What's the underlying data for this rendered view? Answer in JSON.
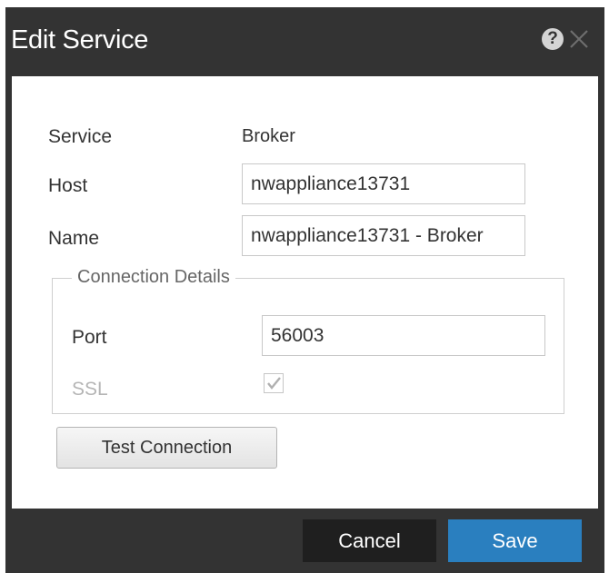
{
  "dialog": {
    "title": "Edit Service",
    "help_icon": "help-circle-icon",
    "close_icon": "close-icon"
  },
  "form": {
    "service_label": "Service",
    "service_value": "Broker",
    "host_label": "Host",
    "host_value": "nwappliance13731",
    "name_label": "Name",
    "name_value": "nwappliance13731 - Broker"
  },
  "connection": {
    "legend": "Connection Details",
    "port_label": "Port",
    "port_value": "56003",
    "ssl_label": "SSL",
    "ssl_checked": true,
    "ssl_disabled": true
  },
  "buttons": {
    "test_connection": "Test Connection",
    "cancel": "Cancel",
    "save": "Save"
  },
  "colors": {
    "titlebar": "#333333",
    "save_accent": "#2a7fbf",
    "cancel_bg": "#1f1f1f"
  }
}
